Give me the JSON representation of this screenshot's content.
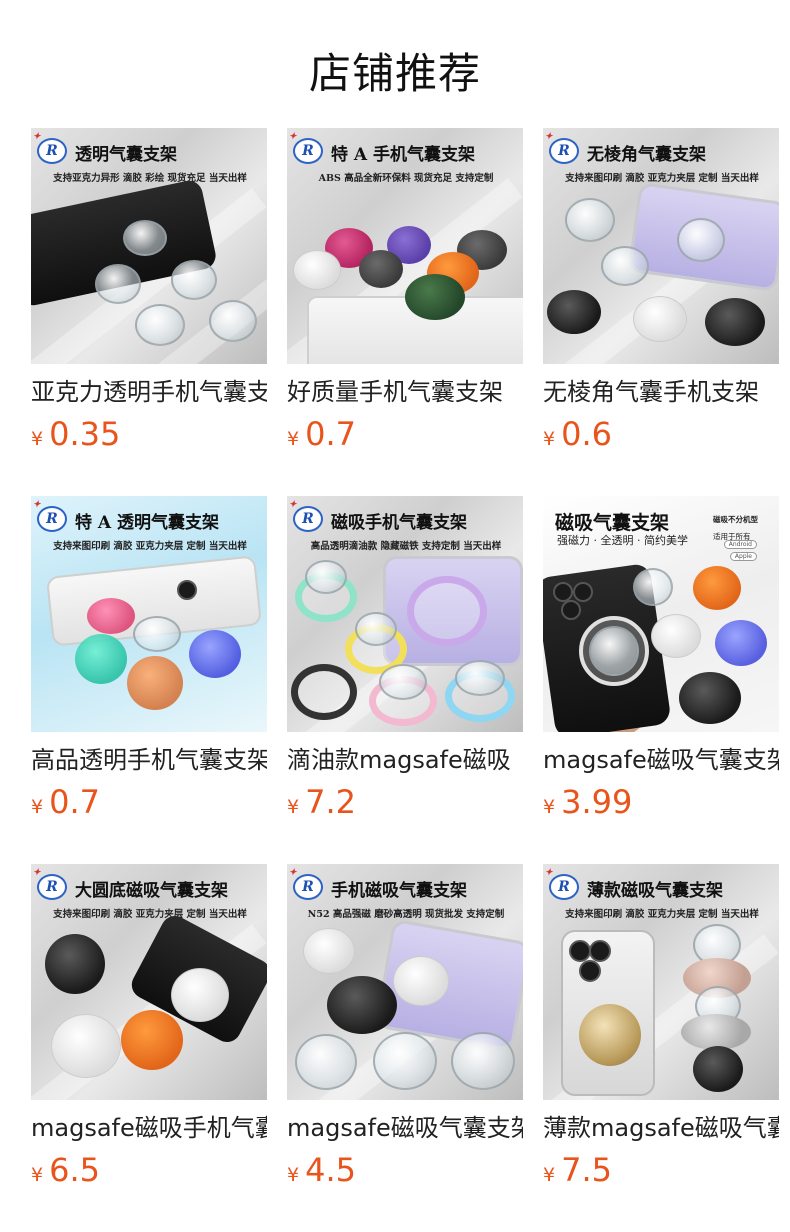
{
  "page": {
    "title": "店铺推荐"
  },
  "currency_symbol": "¥",
  "colors": {
    "price": "#e8541b",
    "title": "#111111",
    "caption": "#222222"
  },
  "products": [
    {
      "name": "亚克力透明手机气囊支架",
      "price": "0.35",
      "image": {
        "title": "透明气囊支架",
        "subtitle": "支持亚克力异形 滴胶 彩绘 现货充足 当天出样"
      }
    },
    {
      "name": "好质量手机气囊支架",
      "price": "0.7",
      "image": {
        "title": "特 A 手机气囊支架",
        "subtitle": "ABS 高品全新环保料 现货充足 支持定制"
      }
    },
    {
      "name": "无棱角气囊手机支架",
      "price": "0.6",
      "image": {
        "title": "无棱角气囊支架",
        "subtitle": "支持来图印刷 滴胶 亚克力夹层 定制 当天出样"
      }
    },
    {
      "name": "高品透明手机气囊支架",
      "price": "0.7",
      "image": {
        "title": "特 A 透明气囊支架",
        "subtitle": "支持来图印刷 滴胶 亚克力夹层 定制 当天出样"
      }
    },
    {
      "name": "滴油款magsafe磁吸",
      "price": "7.2",
      "image": {
        "title": "磁吸手机气囊支架",
        "subtitle": "高品透明滴油款 隐藏磁铁 支持定制 当天出样"
      }
    },
    {
      "name": "magsafe磁吸气囊支架",
      "price": "3.99",
      "image": {
        "title": "磁吸气囊支架",
        "subtitle": "强磁力 · 全透明 · 简约美学",
        "tag_line1": "磁吸不分机型",
        "tag_line2": "适用于所有",
        "tag_android": "Android",
        "tag_apple": "Apple"
      }
    },
    {
      "name": "magsafe磁吸手机气囊支架",
      "price": "6.5",
      "image": {
        "title": "大圆底磁吸气囊支架",
        "subtitle": "支持来图印刷 滴胶 亚克力夹层 定制 当天出样"
      }
    },
    {
      "name": "magsafe磁吸气囊支架",
      "price": "4.5",
      "image": {
        "title": "手机磁吸气囊支架",
        "subtitle": "N52 高品强磁 磨砂高透明 现货批发 支持定制"
      }
    },
    {
      "name": "薄款magsafe磁吸气囊支架",
      "price": "7.5",
      "image": {
        "title": "薄款磁吸气囊支架",
        "subtitle": "支持来图印刷 滴胶 亚克力夹层 定制 当天出样"
      }
    }
  ]
}
